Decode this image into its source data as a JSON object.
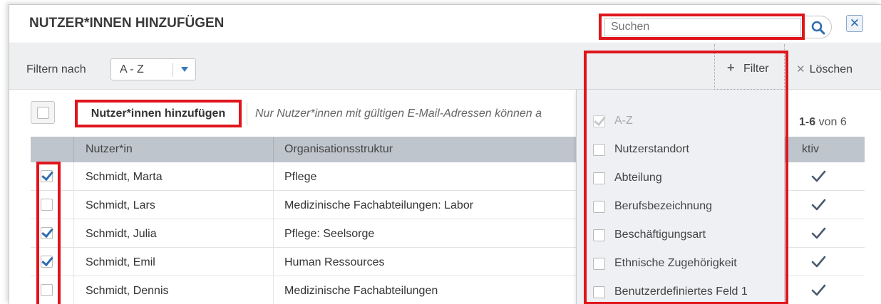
{
  "header": {
    "title": "NUTZER*INNEN HINZUFÜGEN",
    "search_placeholder": "Suchen",
    "close_label": "✕"
  },
  "filterbar": {
    "label": "Filtern nach",
    "select_value": "A - Z",
    "filter_label": "Filter",
    "clear_label": "Löschen"
  },
  "actions": {
    "add_button": "Nutzer*innen hinzufügen",
    "note": "Nur Nutzer*innen mit gültigen E-Mail-Adressen können a",
    "count_range": "1-6",
    "count_total": "von 6"
  },
  "table": {
    "columns": [
      "Nutzer*in",
      "Organisationsstruktur",
      "ktiv"
    ],
    "rows": [
      {
        "checked": true,
        "name": "Schmidt, Marta",
        "org": "Pflege",
        "active": true
      },
      {
        "checked": false,
        "name": "Schmidt, Lars",
        "org": "Medizinische Fachabteilungen: Labor",
        "active": true
      },
      {
        "checked": true,
        "name": "Schmidt, Julia",
        "org": "Pflege: Seelsorge",
        "active": true
      },
      {
        "checked": true,
        "name": "Schmidt, Emil",
        "org": "Human Ressources",
        "active": true
      },
      {
        "checked": false,
        "name": "Schmidt, Dennis",
        "org": "Medizinische Fachabteilungen",
        "active": true
      }
    ]
  },
  "dropdown": {
    "items": [
      {
        "label": "A-Z",
        "checked": true,
        "disabled": true
      },
      {
        "label": "Nutzerstandort",
        "checked": false,
        "disabled": false
      },
      {
        "label": "Abteilung",
        "checked": false,
        "disabled": false
      },
      {
        "label": "Berufsbezeichnung",
        "checked": false,
        "disabled": false
      },
      {
        "label": "Beschäftigungsart",
        "checked": false,
        "disabled": false
      },
      {
        "label": "Ethnische Zugehörigkeit",
        "checked": false,
        "disabled": false
      },
      {
        "label": "Benutzerdefiniertes Feld 1",
        "checked": false,
        "disabled": false
      }
    ]
  },
  "colors": {
    "accent": "#2f6cb1",
    "highlight": "#e0151c",
    "table_header": "#bfc5cd",
    "filterbar_bg": "#eeeff1"
  }
}
